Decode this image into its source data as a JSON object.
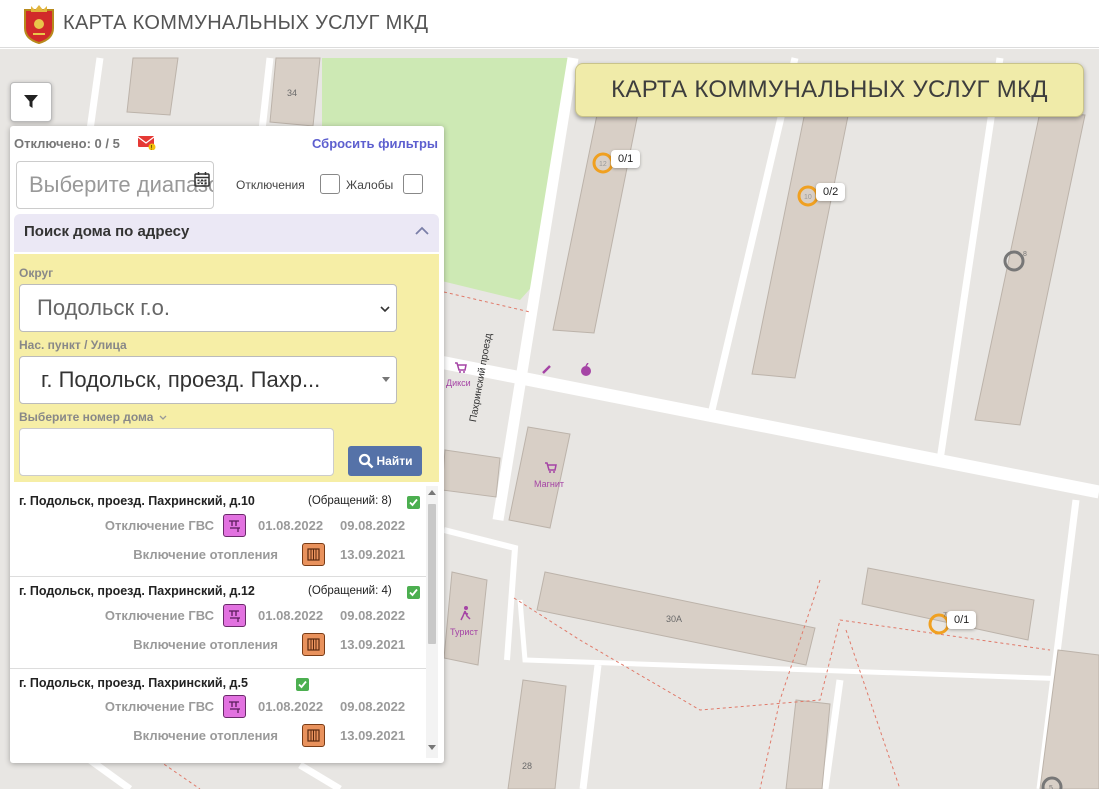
{
  "header": {
    "title": "КАРТА КОММУНАЛЬНЫХ УСЛУГ МКД",
    "logo_icon": "moscow-oblast-emblem"
  },
  "map": {
    "title": "КАРТА КОММУНАЛЬНЫХ УСЛУГ МКД",
    "markers": [
      {
        "num": "12",
        "label": "0/1"
      },
      {
        "num": "10",
        "label": "0/2"
      },
      {
        "num": "8",
        "label": ""
      },
      {
        "num": "7",
        "label": "0/1"
      },
      {
        "num": "5",
        "label": ""
      }
    ],
    "building_numbers": [
      "34",
      "30А",
      "28"
    ],
    "street_name": "Пахринский проезд",
    "pois": [
      "Дикси",
      "Магнит",
      "Турист"
    ],
    "filter_icon": "filter-icon"
  },
  "panel": {
    "off_count": "Отключено: 0 / 5",
    "reset": "Сбросить фильтры",
    "date_placeholder": "Выберите диапазон",
    "chk_off": "Отключения",
    "chk_complaints": "Жалобы",
    "search_title": "Поиск дома по адресу",
    "district_label": "Округ",
    "district_value": "Подольск г.о.",
    "street_label": "Нас. пункт / Улица",
    "street_value": "г. Подольск, проезд. Пахр...",
    "house_label": "Выберите номер дома",
    "find_button": "Найти",
    "results": [
      {
        "address": "г. Подольск, проезд. Пахринский, д.10",
        "count": "(Обращений: 8)",
        "rows": [
          {
            "label": "Отключение ГВС",
            "icon": "hot-water-icon",
            "date_from": "01.08.2022",
            "date_to": "09.08.2022"
          },
          {
            "label": "Включение отопления",
            "icon": "radiator-icon",
            "date_from": "",
            "date_to": "13.09.2021"
          }
        ]
      },
      {
        "address": "г. Подольск, проезд. Пахринский, д.12",
        "count": "(Обращений: 4)",
        "rows": [
          {
            "label": "Отключение ГВС",
            "icon": "hot-water-icon",
            "date_from": "01.08.2022",
            "date_to": "09.08.2022"
          },
          {
            "label": "Включение отопления",
            "icon": "radiator-icon",
            "date_from": "",
            "date_to": "13.09.2021"
          }
        ]
      },
      {
        "address": "г. Подольск, проезд. Пахринский, д.5",
        "count": "",
        "rows": [
          {
            "label": "Отключение ГВС",
            "icon": "hot-water-icon",
            "date_from": "01.08.2022",
            "date_to": "09.08.2022"
          },
          {
            "label": "Включение отопления",
            "icon": "radiator-icon",
            "date_from": "",
            "date_to": "13.09.2021"
          }
        ]
      }
    ]
  }
}
